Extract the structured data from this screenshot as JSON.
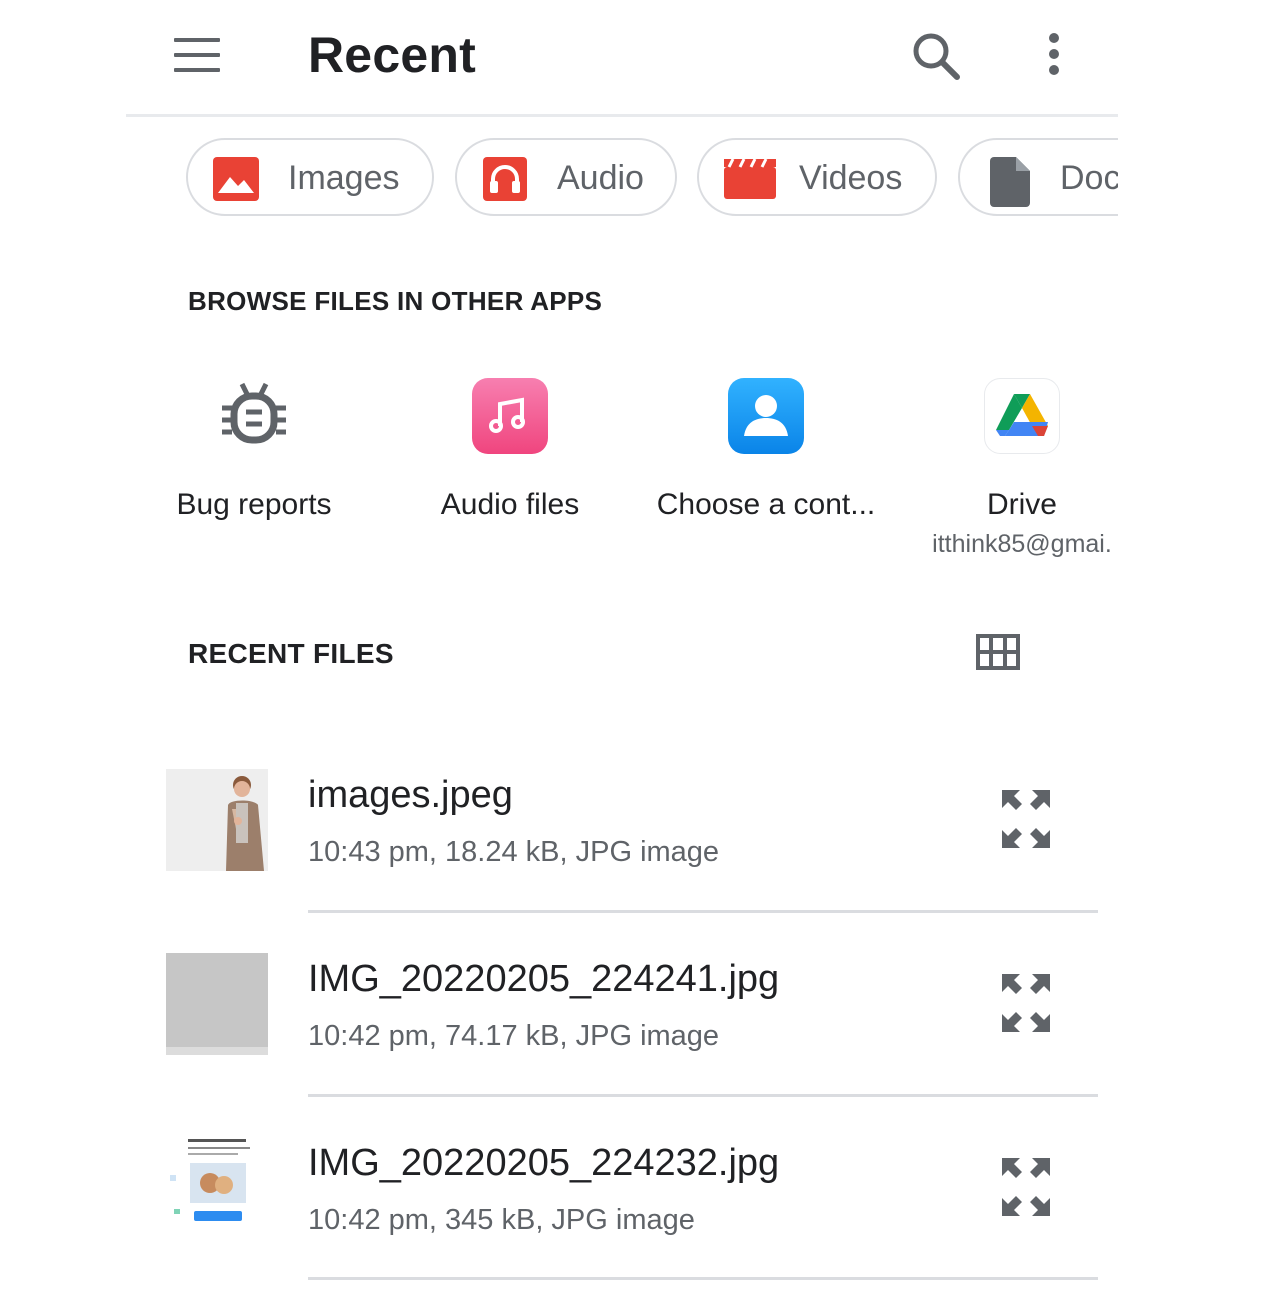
{
  "app_bar": {
    "title": "Recent",
    "menu_icon": "hamburger-menu-icon",
    "search_icon": "search-icon",
    "more_icon": "more-vert-icon"
  },
  "chips": [
    {
      "label": "Images",
      "icon": "image-icon",
      "color": "#e94235"
    },
    {
      "label": "Audio",
      "icon": "headphones-icon",
      "color": "#e94235"
    },
    {
      "label": "Videos",
      "icon": "movie-icon",
      "color": "#e94235"
    },
    {
      "label": "Doc",
      "icon": "document-icon",
      "color": "#5f6368"
    }
  ],
  "browse_section": {
    "title": "BROWSE FILES IN OTHER APPS",
    "apps": [
      {
        "label": "Bug reports",
        "sublabel": "",
        "icon": "bug-icon"
      },
      {
        "label": "Audio files",
        "sublabel": "",
        "icon": "music-note-icon"
      },
      {
        "label": "Choose a cont...",
        "sublabel": "",
        "icon": "contacts-icon"
      },
      {
        "label": "Drive",
        "sublabel": "itthink85@gmai.",
        "icon": "google-drive-icon"
      }
    ]
  },
  "recent_section": {
    "title": "RECENT FILES",
    "grid_toggle_icon": "grid-view-icon",
    "files": [
      {
        "name": "images.jpeg",
        "meta": "10:43 pm, 18.24 kB, JPG image",
        "thumb": "person-photo"
      },
      {
        "name": "IMG_20220205_224241.jpg",
        "meta": "10:42 pm, 74.17 kB, JPG image",
        "thumb": "blank-gray"
      },
      {
        "name": "IMG_20220205_224232.jpg",
        "meta": "10:42 pm, 345 kB, JPG image",
        "thumb": "document-screenshot"
      }
    ]
  },
  "colors": {
    "accent_red": "#e94235",
    "audio_pink": "#f06292",
    "contacts_blue": "#1a9bf0",
    "secondary_text": "#5f6368",
    "divider": "#dadce0"
  }
}
